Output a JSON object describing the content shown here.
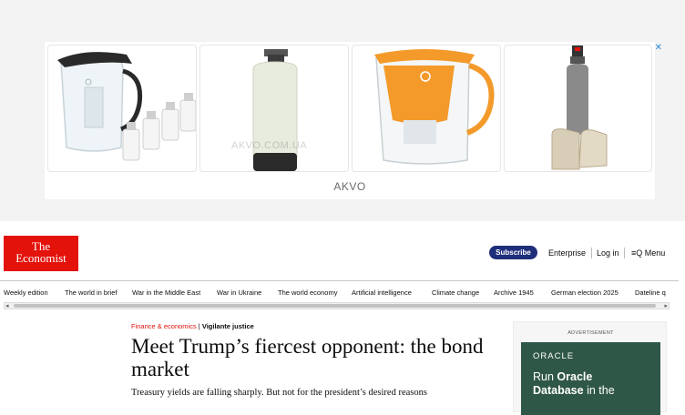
{
  "ad": {
    "brand": "AKVO",
    "watermark": "AKVO.COM.UA",
    "products": [
      "water-filter-pitcher-with-cartridges",
      "water-softener-tank",
      "orange-filter-pitcher",
      "industrial-filter-with-salt-bags"
    ]
  },
  "header": {
    "logo_line1": "The",
    "logo_line2": "Economist",
    "subscribe": "Subscribe",
    "enterprise": "Enterprise",
    "login": "Log in",
    "menu": "Menu"
  },
  "nav": {
    "items": [
      "Weekly edition",
      "The world in brief",
      "War in the Middle East",
      "War in Ukraine",
      "The world economy",
      "Artificial intelligence",
      "Climate change",
      "Archive 1945",
      "German election 2025",
      "Dateline q"
    ]
  },
  "article": {
    "section": "Finance & economics",
    "fly_title": "Vigilante justice",
    "headline": "Meet Trump’s fiercest opponent: the bond market",
    "standfirst": "Treasury yields are falling sharply. But not for the president’s desired reasons"
  },
  "side_ad": {
    "label": "ADVERTISEMENT",
    "logo": "ORACLE",
    "text_pre": "Run ",
    "text_bold1": "Oracle",
    "text_bold2": "Database",
    "text_post": " in the"
  },
  "colors": {
    "economist_red": "#e3120b",
    "subscribe_blue": "#1f2e7a",
    "oracle_green": "#2f5747",
    "ad_pitcher_orange": "#f39a2b"
  }
}
